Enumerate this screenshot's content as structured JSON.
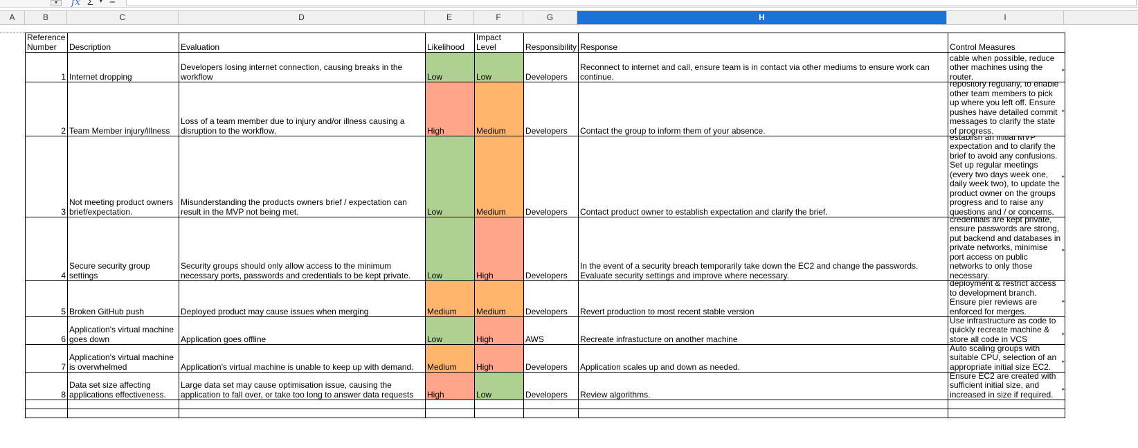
{
  "columns": [
    "A",
    "B",
    "C",
    "D",
    "E",
    "F",
    "G",
    "H",
    "I"
  ],
  "selected_column": "H",
  "headers": {
    "ref": "Reference Number",
    "description": "Description",
    "evaluation": "Evaluation",
    "likelihood": "Likelihood",
    "impact": "Impact Level",
    "responsibility": "Responsibility",
    "response": "Response",
    "control": "Control Measures"
  },
  "level_colors": {
    "High": "#ffa58a",
    "Medium": "#ffb66c",
    "Low": "#aed191"
  },
  "risks": [
    {
      "ref": "1",
      "description": "Internet dropping",
      "evaluation": "Developers losing internet connection, causing breaks in the workflow",
      "likelihood": "Low",
      "impact": "Low",
      "responsibility": "Developers",
      "response": "Reconnect to internet and call, ensure team is in contact via other mediums to ensure work can continue.",
      "control": "cable when possible, reduce other machines using the router."
    },
    {
      "ref": "2",
      "description": "Team Member injury/illness",
      "evaluation": "Loss of a team member due to injury and/or illness causing a disruption to the workflow.",
      "likelihood": "High",
      "impact": "Medium",
      "responsibility": "Developers",
      "response": "Contact the group to inform them of your absence.",
      "control": "repository regularly, to enable other team members to pick up where you left off. Ensure pushes have detailed commit messages to clarify the state of progress."
    },
    {
      "ref": "3",
      "description": "Not meeting product owners brief/expectation.",
      "evaluation": "Misunderstanding the products owners brief / expectation can result in the MVP not being met.",
      "likelihood": "Low",
      "impact": "Medium",
      "responsibility": "Developers",
      "response": "Contact product owner to establish expectation and clarify the brief.",
      "control": "establish an initial MVP expectation and to clarify the brief to avoid any confusions. Set up regular meetings (every two days week one, daily week two), to update the product owner on the groups progress and to raise any questions and / or concerns."
    },
    {
      "ref": "4",
      "description": "Secure security group settings",
      "evaluation": "Security groups should only allow access to the minimum necessary ports, passwords and credentials to be kept private.",
      "likelihood": "Low",
      "impact": "High",
      "responsibility": "Developers",
      "response": "In the event of a security breach temporarily take down the EC2 and change the passwords. Evaluate security settings and improve where necessary.",
      "control": "Ensure passwords and credentials are kept private, ensure passwords are strong, put backend and databases in private networks, minimise port access on public networks to only those necessary."
    },
    {
      "ref": "5",
      "description": "Broken GitHub push",
      "evaluation": "Deployed product may cause issues when merging",
      "likelihood": "Medium",
      "impact": "Medium",
      "responsibility": "Developers",
      "response": "Revert production to most recent stable version",
      "control": "deployment & restrict access to development branch. Ensure pier reviews are enforced for merges."
    },
    {
      "ref": "6",
      "description": "Application's virtual machine goes down",
      "evaluation": "Application goes offline",
      "likelihood": "Low",
      "impact": "High",
      "responsibility": "AWS",
      "response": "Recreate infrastucture on another machine",
      "control": "Use infrastructure as code to quickly recreate machine & store all code in VCS"
    },
    {
      "ref": "7",
      "description": "Application's virtual machine is overwhelmed",
      "evaluation": "Application's virtual machine is unable to keep up with demand.",
      "likelihood": "Medium",
      "impact": "High",
      "responsibility": "Developers",
      "response": "Application scales up and down as needed.",
      "control": "Auto scaling groups with suitable CPU, selection of an appropriate initial size EC2."
    },
    {
      "ref": "8",
      "description": "Data set size affecting applications effectiveness.",
      "evaluation": "Large data set may cause optimisation issue, causing the application to fall over, or take too long to answer data requests",
      "likelihood": "High",
      "impact": "Low",
      "responsibility": "Developers",
      "response": "Review algorithms.",
      "control": "Ensure EC2 are created with sufficient initial size, and increased in size if required."
    }
  ]
}
